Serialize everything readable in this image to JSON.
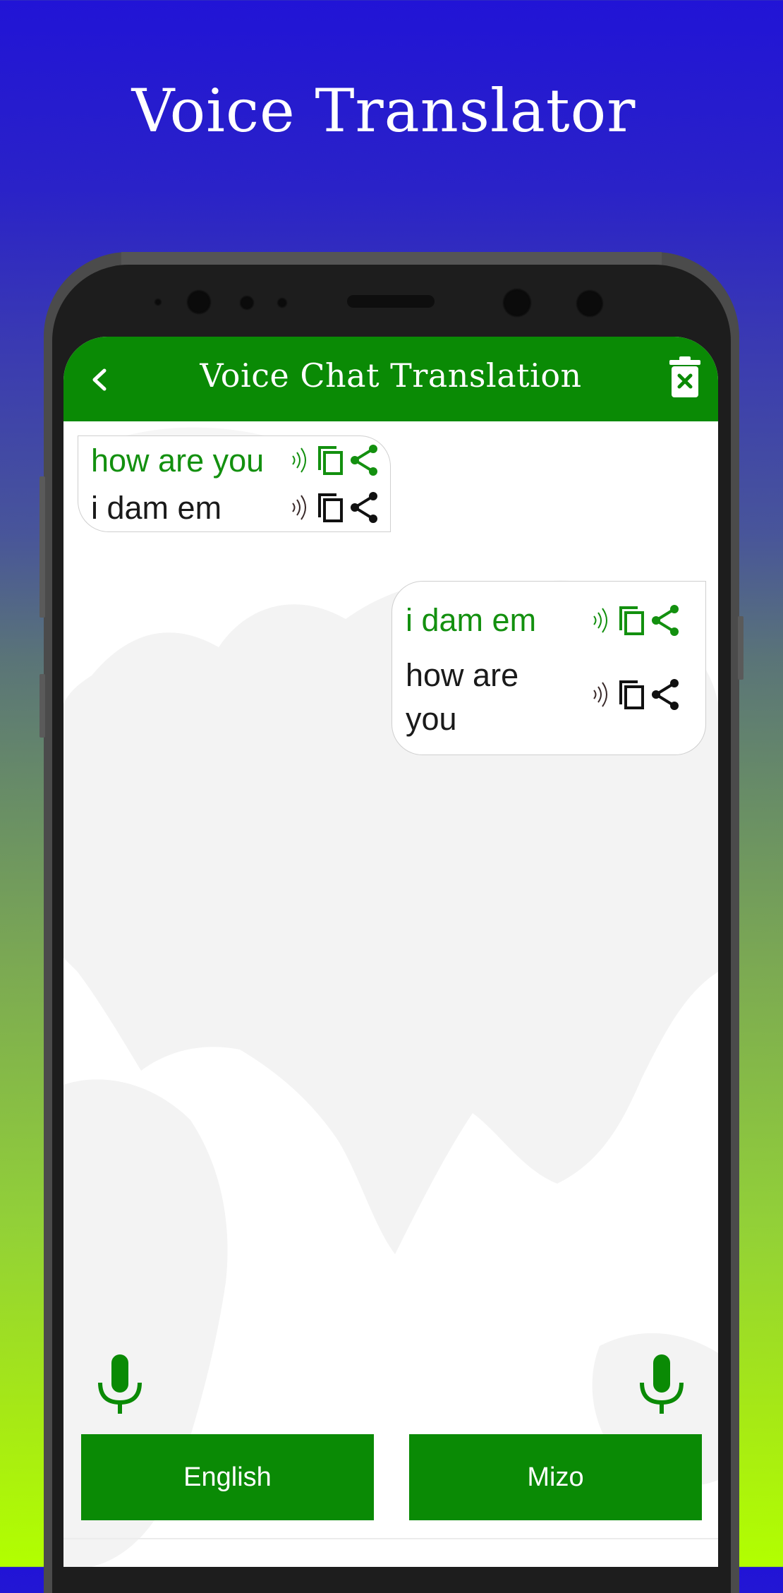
{
  "promo": {
    "title": "Voice Translator"
  },
  "header": {
    "title": "Voice Chat Translation",
    "back_icon": "chevron-left-icon",
    "delete_icon": "trash-x-icon"
  },
  "messages": [
    {
      "side": "left",
      "source_text": "how are you",
      "translated_text": "i dam em",
      "actions": [
        "speaker-icon",
        "copy-icon",
        "share-icon"
      ]
    },
    {
      "side": "right",
      "source_text": "i dam em",
      "translated_text": "how are you",
      "actions": [
        "speaker-icon",
        "copy-icon",
        "share-icon"
      ]
    }
  ],
  "footer": {
    "left_mic_icon": "microphone-icon",
    "right_mic_icon": "microphone-icon",
    "source_language": "English",
    "target_language": "Mizo"
  },
  "colors": {
    "primary_green": "#0a8a05",
    "source_text_green": "#13900f",
    "gradient_top": "#2114d6",
    "gradient_bottom": "#b2ff00"
  }
}
